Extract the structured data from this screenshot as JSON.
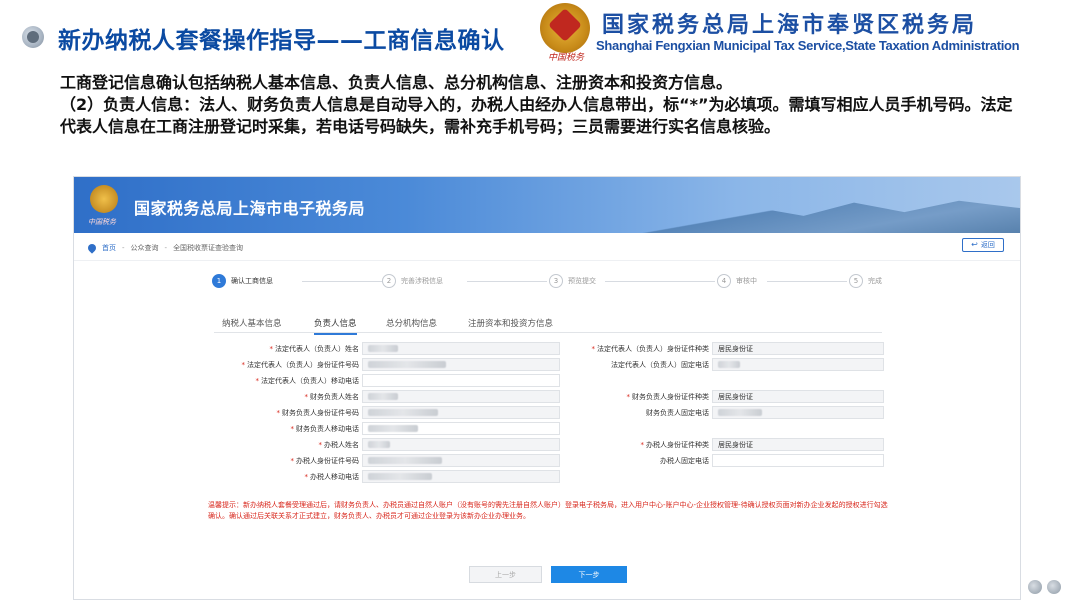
{
  "slide": {
    "title": "新办纳税人套餐操作指导——工商信息确认",
    "agency_cn": "国家税务总局上海市奉贤区税务局",
    "agency_en": "Shanghai Fengxian Municipal Tax Service,State Taxation Administration",
    "description_line1": "工商登记信息确认包括纳税人基本信息、负责人信息、总分机构信息、注册资本和投资方信息。",
    "description_line2": "（2）负责人信息：法人、财务负责人信息是自动导入的，办税人由经办人信息带出，标“*”为必填项。需填写相应人员手机号码。法定代表人信息在工商注册登记时采集，若电话号码缺失，需补充手机号码；三员需要进行实名信息核验。"
  },
  "portal": {
    "banner_title": "国家税务总局上海市电子税务局",
    "breadcrumb": [
      "首页",
      "公众查询",
      "全国税收票证查验查询"
    ],
    "back_label": "返回",
    "steps": [
      {
        "num": "1",
        "label": "确认工商信息",
        "active": true
      },
      {
        "num": "2",
        "label": "完善涉税信息",
        "active": false
      },
      {
        "num": "3",
        "label": "预览提交",
        "active": false
      },
      {
        "num": "4",
        "label": "审核中",
        "active": false
      },
      {
        "num": "5",
        "label": "完成",
        "active": false
      }
    ],
    "tabs": [
      "纳税人基本信息",
      "负责人信息",
      "总分机构信息",
      "注册资本和投资方信息"
    ],
    "active_tab": "负责人信息",
    "left_fields": [
      {
        "label": "法定代表人（负责人）姓名",
        "required": true,
        "value": ""
      },
      {
        "label": "法定代表人（负责人）身份证件号码",
        "required": true,
        "value": ""
      },
      {
        "label": "法定代表人（负责人）移动电话",
        "required": true,
        "value": ""
      },
      {
        "label": "财务负责人姓名",
        "required": true,
        "value": ""
      },
      {
        "label": "财务负责人身份证件号码",
        "required": true,
        "value": ""
      },
      {
        "label": "财务负责人移动电话",
        "required": true,
        "value": ""
      },
      {
        "label": "办税人姓名",
        "required": true,
        "value": ""
      },
      {
        "label": "办税人身份证件号码",
        "required": true,
        "value": ""
      },
      {
        "label": "办税人移动电话",
        "required": true,
        "value": ""
      }
    ],
    "right_fields": [
      {
        "label": "法定代表人（负责人）身份证件种类",
        "required": true,
        "value": "居民身份证"
      },
      {
        "label": "法定代表人（负责人）固定电话",
        "required": false,
        "value": ""
      },
      {
        "label": "财务负责人身份证件种类",
        "required": true,
        "value": "居民身份证"
      },
      {
        "label": "财务负责人固定电话",
        "required": false,
        "value": ""
      },
      {
        "label": "办税人身份证件种类",
        "required": true,
        "value": "居民身份证"
      },
      {
        "label": "办税人固定电话",
        "required": false,
        "value": ""
      }
    ],
    "hint": "温馨提示：新办纳税人套餐受理通过后，请财务负责人、办税员通过自然人账户（没有账号的需先注册自然人账户）登录电子税务局，进入用户中心-账户中心-企业授权管理-待确认授权页面对新办企业发起的授权进行勾选确认。确认通过后关联关系才正式建立，财务负责人、办税员才可通过企业登录为该新办企业办理业务。",
    "prev_label": "上一步",
    "next_label": "下一步"
  },
  "colors": {
    "title_blue": "#0b4aa2",
    "primary": "#2f7ad8",
    "required": "#d8271c"
  }
}
